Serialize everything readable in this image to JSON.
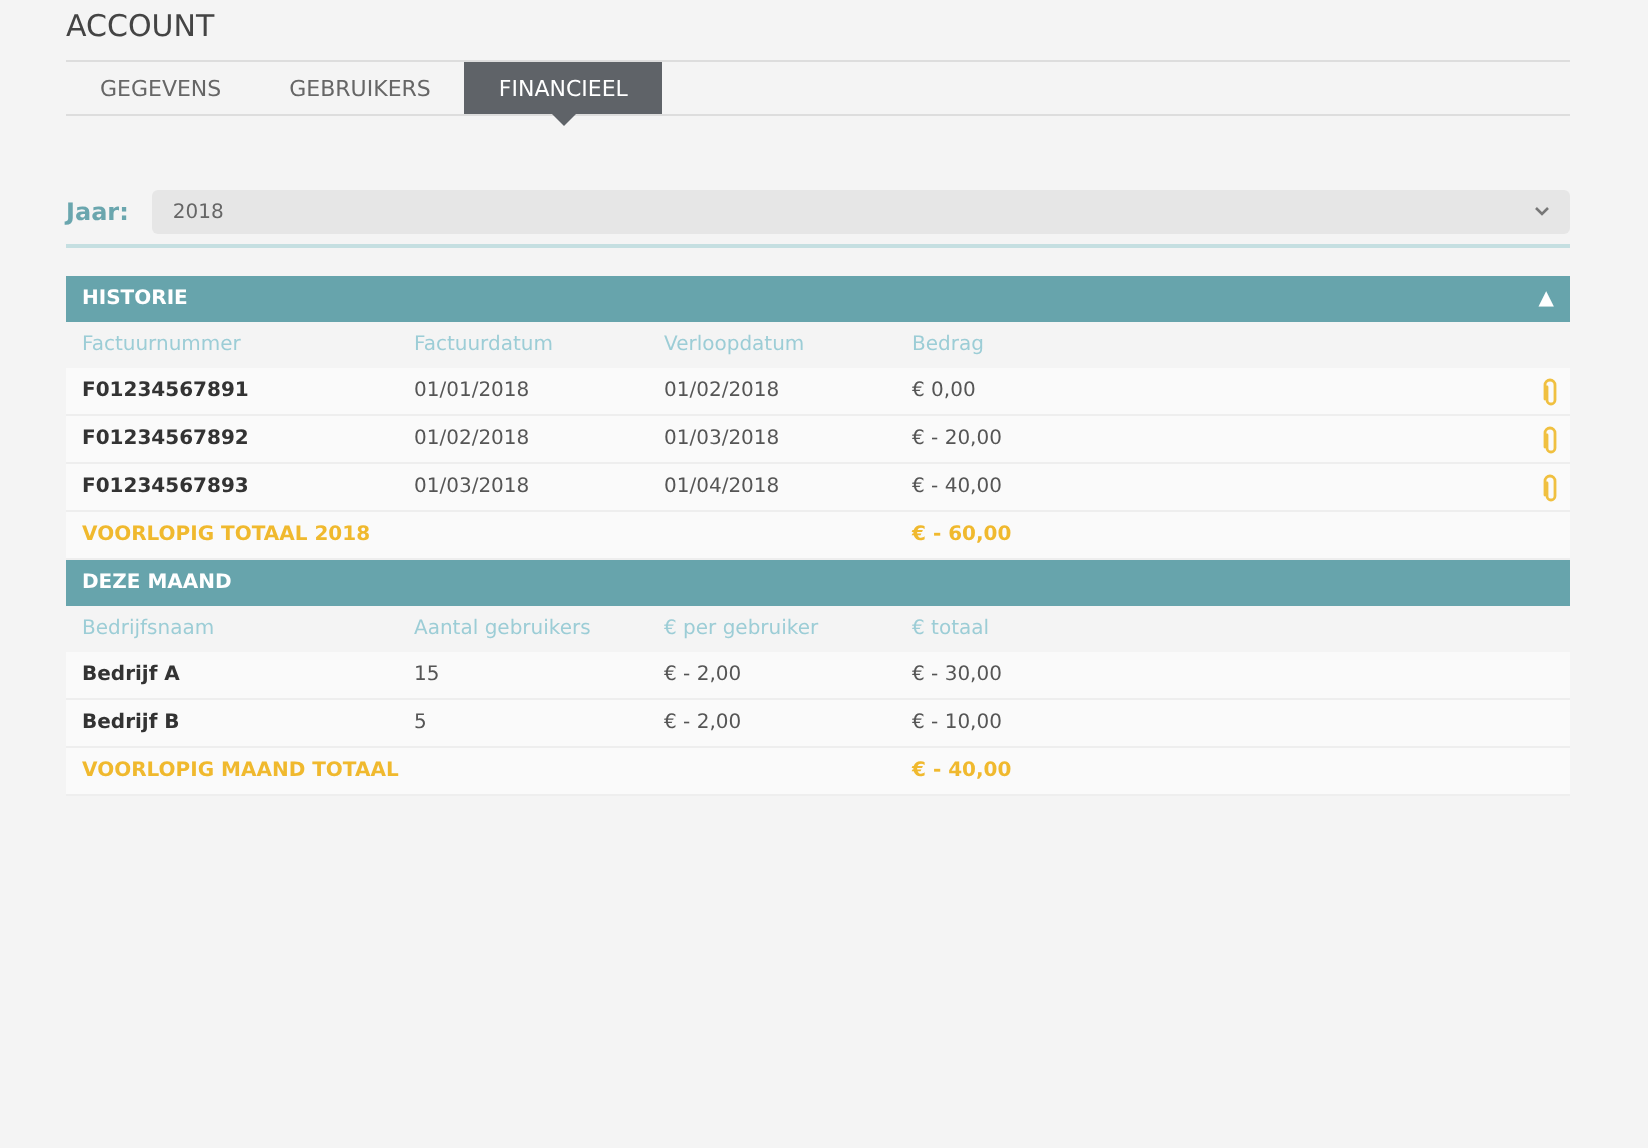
{
  "page_title": "ACCOUNT",
  "tabs": [
    {
      "label": "GEGEVENS",
      "selected": false
    },
    {
      "label": "GEBRUIKERS",
      "selected": false
    },
    {
      "label": "FINANCIEEL",
      "selected": true
    }
  ],
  "year_filter": {
    "label": "Jaar:",
    "value": "2018"
  },
  "sections": [
    {
      "title": "HISTORIE",
      "toggle": "▲",
      "columns": [
        "Factuurnummer",
        "Factuurdatum",
        "Verloopdatum",
        "Bedrag"
      ],
      "rows": [
        {
          "cells": [
            "F01234567891",
            "01/01/2018",
            "01/02/2018",
            "€ 0,00"
          ],
          "attachment": true
        },
        {
          "cells": [
            "F01234567892",
            "01/02/2018",
            "01/03/2018",
            "€ - 20,00"
          ],
          "attachment": true
        },
        {
          "cells": [
            "F01234567893",
            "01/03/2018",
            "01/04/2018",
            "€ - 40,00"
          ],
          "attachment": true
        }
      ],
      "total": {
        "label": "VOORLOPIG TOTAAL 2018",
        "amount": "€ - 60,00"
      }
    },
    {
      "title": "DEZE MAAND",
      "columns": [
        "Bedrijfsnaam",
        "Aantal gebruikers",
        "€ per gebruiker",
        "€ totaal"
      ],
      "rows": [
        {
          "cells": [
            "Bedrijf A",
            "15",
            "€ - 2,00",
            "€ - 30,00"
          ],
          "attachment": false
        },
        {
          "cells": [
            "Bedrijf B",
            "5",
            "€ - 2,00",
            "€ - 10,00"
          ],
          "attachment": false
        }
      ],
      "total": {
        "label": "VOORLOPIG MAAND TOTAAL",
        "amount": "€ - 40,00"
      }
    }
  ]
}
